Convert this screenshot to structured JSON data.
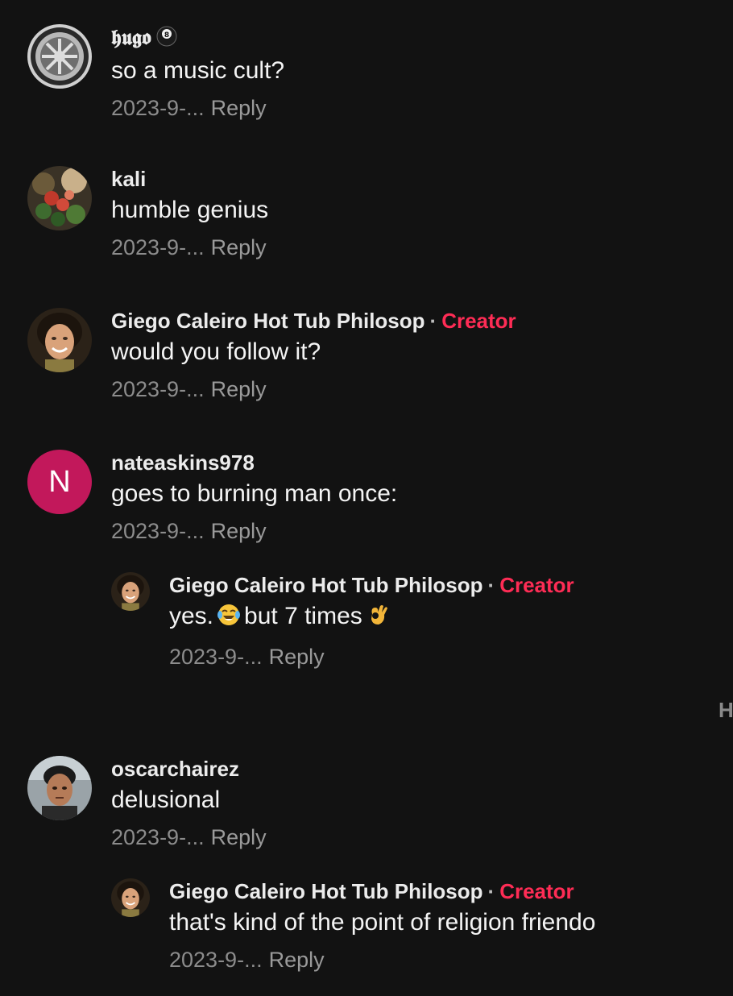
{
  "comments": [
    {
      "username": "𝖍𝖚𝖌𝖔",
      "username_icon": "8-ball-icon",
      "text": "so a music cult?",
      "date": "2023-9-...",
      "reply_label": "Reply"
    },
    {
      "username": "kali",
      "text": "humble genius",
      "date": "2023-9-...",
      "reply_label": "Reply"
    },
    {
      "username": "Giego Caleiro Hot Tub Philosop",
      "separator": "·",
      "badge": "Creator",
      "text": "would you follow it?",
      "date": "2023-9-...",
      "reply_label": "Reply"
    },
    {
      "username": "nateaskins978",
      "avatar_initial": "N",
      "avatar_color": "#c2185b",
      "text": "goes to burning man once:",
      "date": "2023-9-...",
      "reply_label": "Reply",
      "reply": {
        "username": "Giego Caleiro Hot Tub Philosop",
        "separator": "·",
        "badge": "Creator",
        "text_part1": "yes.",
        "text_part2": "but 7 times",
        "emojis": [
          "tears-of-joy-emoji",
          "ok-hand-emoji"
        ],
        "date": "2023-9-...",
        "reply_label": "Reply"
      }
    },
    {
      "username": "oscarchairez",
      "text": "delusional",
      "date": "2023-9-...",
      "reply_label": "Reply",
      "reply": {
        "username": "Giego Caleiro Hot Tub Philosop",
        "separator": "·",
        "badge": "Creator",
        "text": "that's kind of the point of religion friendo",
        "date": "2023-9-...",
        "reply_label": "Reply"
      }
    }
  ],
  "edge_text": "H",
  "colors": {
    "background": "#121212",
    "creator_badge": "#fe2c55",
    "meta_text": "#8c8c8c"
  }
}
